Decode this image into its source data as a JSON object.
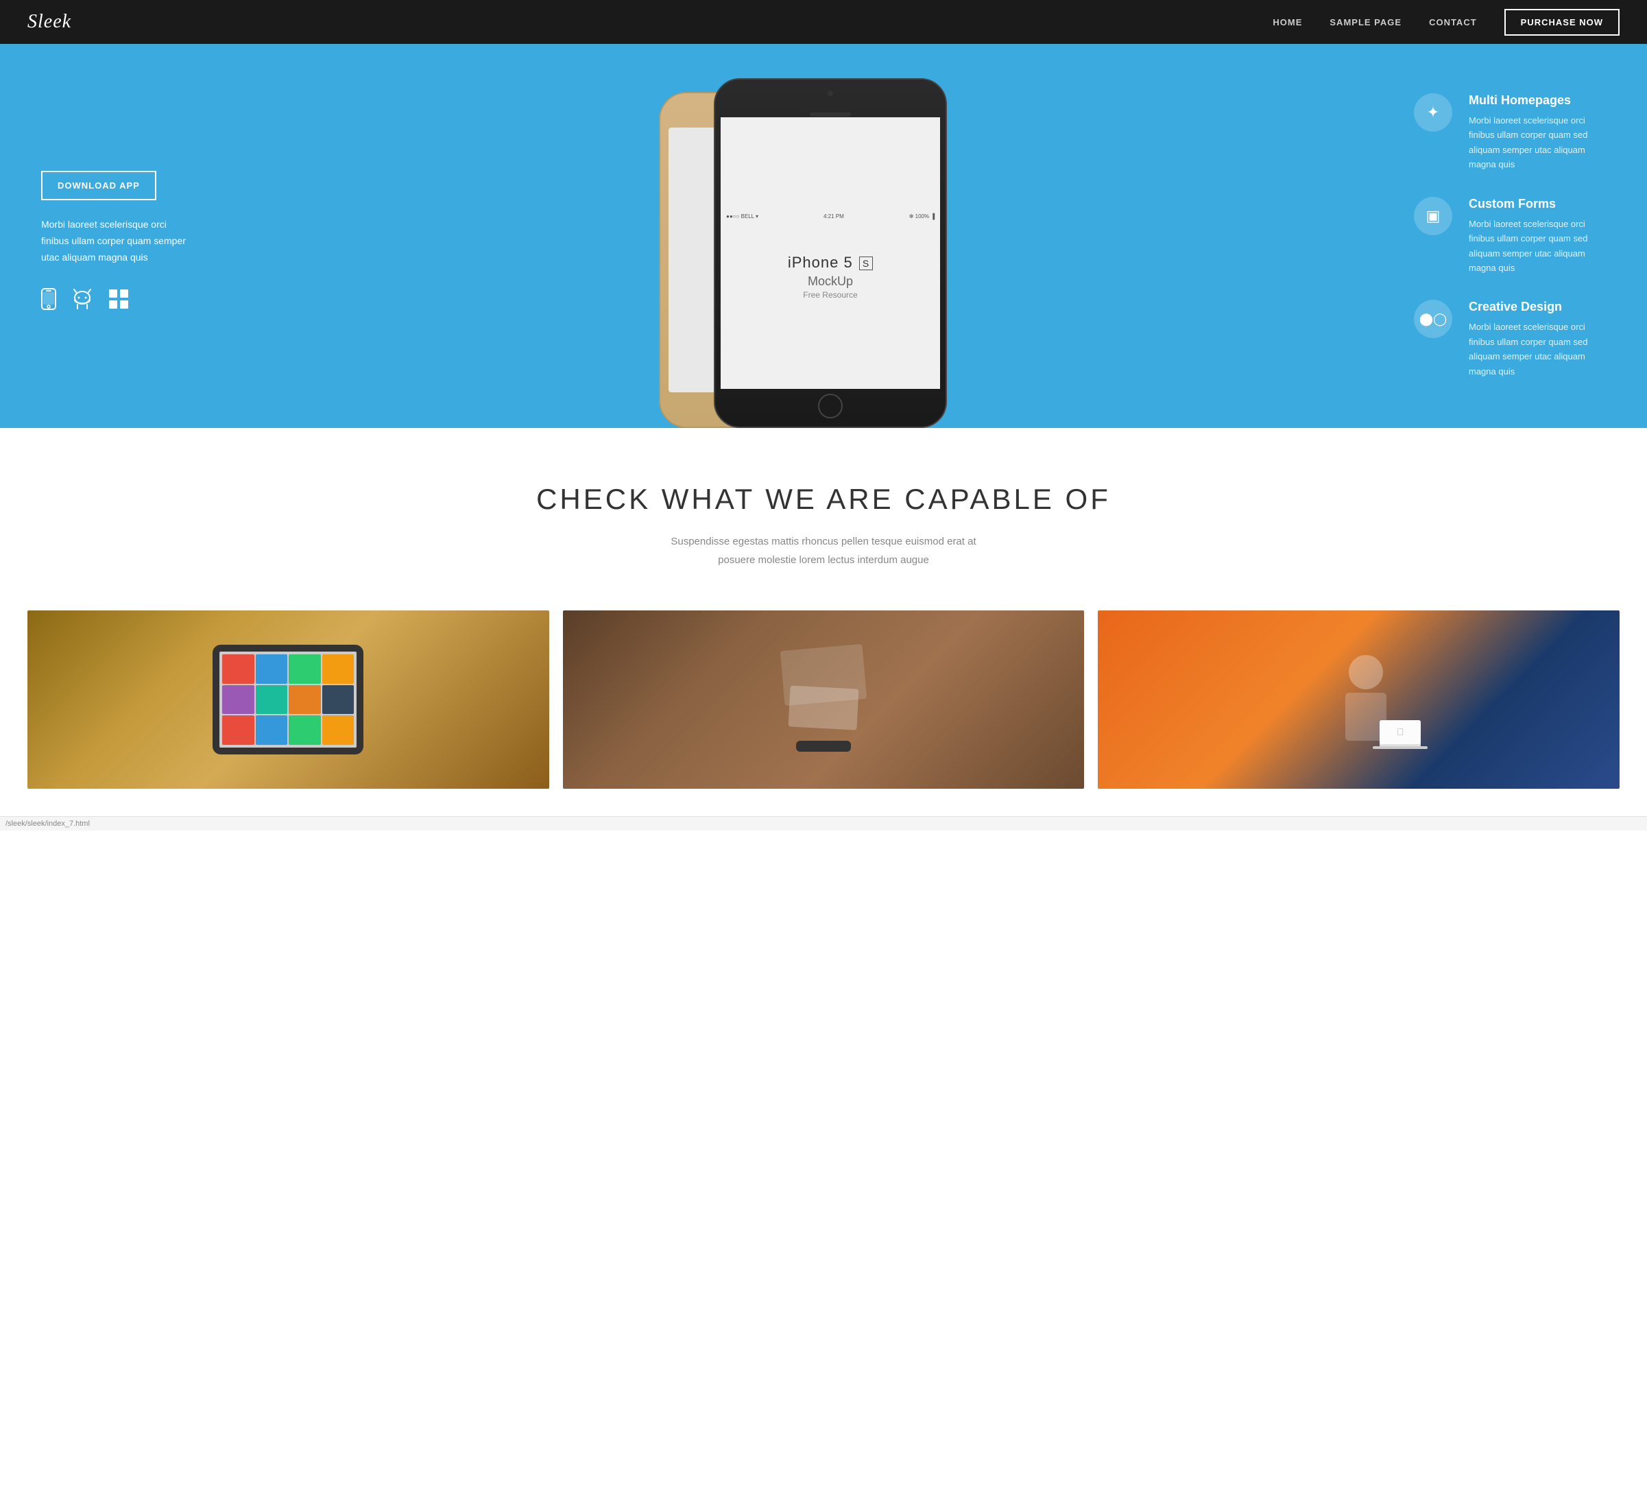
{
  "nav": {
    "logo": "Sleek",
    "links": [
      {
        "id": "home",
        "label": "HOME"
      },
      {
        "id": "sample-page",
        "label": "SAMPLE PAGE"
      },
      {
        "id": "contact",
        "label": "CONTACT"
      }
    ],
    "purchase_button": "PURCHASE NOW"
  },
  "hero": {
    "download_button": "DOWNLOAD APP",
    "description": "Morbi laoreet scelerisque orci finibus ullam corper quam semper utac aliquam magna quis",
    "icons": [
      {
        "id": "ios",
        "symbol": "📱",
        "label": "iOS"
      },
      {
        "id": "android",
        "symbol": "🤖",
        "label": "Android"
      },
      {
        "id": "windows",
        "symbol": "⊞",
        "label": "Windows"
      }
    ],
    "phone": {
      "status": "●●○○ BELL  4:21 PM  ✻ 100%",
      "title": "iPhone 5",
      "variant": "S",
      "subtitle": "MockUp",
      "free": "Free Resource"
    },
    "features": [
      {
        "id": "multi-homepages",
        "icon": "✦",
        "title": "Multi Homepages",
        "description": "Morbi laoreet scelerisque orci finibus ullam corper quam sed aliquam semper utac aliquam magna quis"
      },
      {
        "id": "custom-forms",
        "icon": "▣",
        "title": "Custom Forms",
        "description": "Morbi laoreet scelerisque orci finibus ullam corper quam sed aliquam semper utac aliquam magna quis"
      },
      {
        "id": "creative-design",
        "icon": "◎",
        "title": "Creative Design",
        "description": "Morbi laoreet scelerisque orci finibus ullam corper quam sed aliquam semper utac aliquam magna quis"
      }
    ]
  },
  "capabilities": {
    "heading": "CHECK WHAT WE ARE CAPABLE OF",
    "subtext_line1": "Suspendisse egestas mattis rhoncus pellen tesque euismod erat at",
    "subtext_line2": "posuere molestie lorem lectus interdum augue"
  },
  "gallery": {
    "items": [
      {
        "id": "tablet",
        "type": "tablet"
      },
      {
        "id": "stationery",
        "type": "stationery"
      },
      {
        "id": "person",
        "type": "person"
      }
    ]
  },
  "footer": {
    "status_bar": "/sleek/sleek/index_7.html"
  },
  "colors": {
    "nav_bg": "#1a1a1a",
    "hero_bg": "#3aaadf",
    "feature_icon_bg": "rgba(255,255,255,0.2)",
    "capabilities_bg": "#ffffff",
    "text_dark": "#333333",
    "text_muted": "#888888",
    "text_white": "#ffffff",
    "gallery_item1": "#8B6914",
    "gallery_item2": "#5a3e28",
    "gallery_item3": "#e8671a"
  }
}
